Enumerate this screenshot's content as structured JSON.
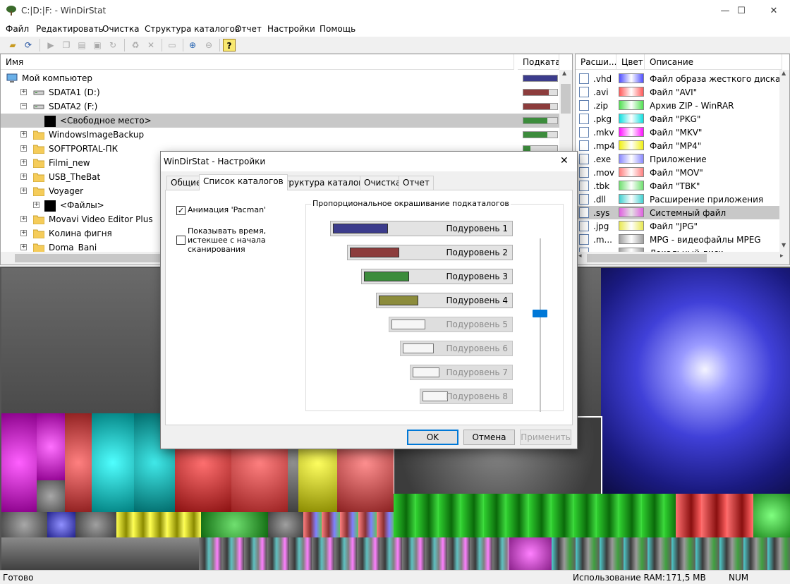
{
  "window": {
    "title": "C:|D:|F: - WinDirStat",
    "minimize_glyph": "—",
    "maximize_glyph": "☐",
    "close_glyph": "✕"
  },
  "menu": [
    "Файл",
    "Редактировать",
    "Очистка",
    "Структура каталогов",
    "Отчет",
    "Настройки",
    "Помощь"
  ],
  "toolbar_icons": [
    "open-folder-icon",
    "refresh-icon",
    "play-icon",
    "copy-icon",
    "explorer-icon",
    "cmd-icon",
    "refresh-selected-icon",
    "recycle-icon",
    "delete-icon",
    "new-folder-icon",
    "zoom-in-icon",
    "zoom-out-icon",
    "help-icon"
  ],
  "tree": {
    "columns": {
      "name": "Имя",
      "subtree": "Подкатал"
    },
    "rows": [
      {
        "name": "Мой компьютер",
        "icon": "computer-icon",
        "expander": "",
        "fill": 1.0,
        "color": "#3c3c8c"
      },
      {
        "name": "SDATA1 (D:)",
        "icon": "drive-icon",
        "expander": "+",
        "fill": 0.75,
        "color": "#8c3c3c"
      },
      {
        "name": "SDATA2 (F:)",
        "icon": "drive-icon",
        "expander": "−",
        "fill": 0.8,
        "color": "#8c3c3c"
      },
      {
        "name": "<Свободное место>",
        "icon": "black-square-icon",
        "expander": "",
        "fill": 0.7,
        "color": "#3c8c3c"
      },
      {
        "name": "WindowsImageBackup",
        "icon": "folder-icon",
        "expander": "+",
        "fill": 0.7,
        "color": "#3c8c3c"
      },
      {
        "name": "SOFTPORTAL-ПК",
        "icon": "folder-icon",
        "expander": "+",
        "fill": 0.2,
        "color": "#3c8c3c"
      },
      {
        "name": "Filmi_new",
        "icon": "folder-icon",
        "expander": "+",
        "fill": 0.0,
        "color": "#3c8c3c"
      },
      {
        "name": "USB_TheBat",
        "icon": "folder-icon",
        "expander": "+",
        "fill": 0.0,
        "color": "#3c8c3c"
      },
      {
        "name": "Voyager",
        "icon": "folder-icon",
        "expander": "+",
        "fill": 0.0,
        "color": "#3c8c3c"
      },
      {
        "name": "<Файлы>",
        "icon": "black-square-icon",
        "expander": "+",
        "fill": 0.0,
        "color": "#3c8c3c"
      },
      {
        "name": "Movavi Video Editor Plus",
        "icon": "folder-icon",
        "expander": "+",
        "fill": 0.0,
        "color": "#3c8c3c"
      },
      {
        "name": "Колина фигня",
        "icon": "folder-icon",
        "expander": "+",
        "fill": 0.0,
        "color": "#3c8c3c"
      },
      {
        "name": "Doma_Bani",
        "icon": "folder-icon",
        "expander": "+",
        "fill": 0.0,
        "color": "#3c8c3c"
      }
    ]
  },
  "extensions": {
    "columns": {
      "ext": "Расши...",
      "color": "Цвет",
      "desc": "Описание",
      "extra": "1"
    },
    "rows": [
      {
        "ext": ".vhd",
        "color": "#5050ff",
        "desc": "Файл образа жесткого диска",
        "icon": "drive-icon"
      },
      {
        "ext": ".avi",
        "color": "#ff5a5a",
        "desc": "Файл \"AVI\"",
        "icon": "video-file-icon"
      },
      {
        "ext": ".zip",
        "color": "#50e050",
        "desc": "Архив ZIP - WinRAR",
        "icon": "winrar-icon"
      },
      {
        "ext": ".pkg",
        "color": "#10e0e0",
        "desc": "Файл \"PKG\"",
        "icon": "file-icon"
      },
      {
        "ext": ".mkv",
        "color": "#ff10ff",
        "desc": "Файл \"MKV\"",
        "icon": "video-file-icon"
      },
      {
        "ext": ".mp4",
        "color": "#f0f010",
        "desc": "Файл \"MP4\"",
        "icon": "video-file-icon"
      },
      {
        "ext": ".exe",
        "color": "#8a8aff",
        "desc": "Приложение",
        "icon": "exe-icon"
      },
      {
        "ext": ".mov",
        "color": "#ff8080",
        "desc": "Файл \"MOV\"",
        "icon": "video-file-icon"
      },
      {
        "ext": ".tbk",
        "color": "#70e070",
        "desc": "Файл \"TBK\"",
        "icon": "file-icon"
      },
      {
        "ext": ".dll",
        "color": "#40d0d0",
        "desc": "Расширение приложения",
        "icon": "dll-icon"
      },
      {
        "ext": ".sys",
        "color": "#e060e0",
        "desc": "Системный файл",
        "icon": "sys-icon"
      },
      {
        "ext": ".jpg",
        "color": "#e8e850",
        "desc": "Файл \"JPG\"",
        "icon": "image-file-icon"
      },
      {
        "ext": ".m...",
        "color": "#a0a0a0",
        "desc": "MPG - видеофайлы MPEG",
        "icon": "mpg-icon"
      },
      {
        "ext": "",
        "color": "#a0a0a0",
        "desc": "Локальный диск",
        "icon": "drive-icon"
      }
    ]
  },
  "dialog": {
    "title": "WinDirStat - Настройки",
    "close_glyph": "✕",
    "tabs": [
      "Общие",
      "Список каталогов",
      "Структура каталогов",
      "Очистка",
      "Отчет"
    ],
    "active_tab": 1,
    "pacman_label": "Анимация 'Pacman'",
    "pacman_checked": true,
    "show_time_label": "Показывать время, истекшее с начала сканирования",
    "show_time_checked": false,
    "group_title": "Пропорциональное окрашивание подкаталогов",
    "levels": [
      {
        "label": "Подуровень 1",
        "color": "#3c3c8c",
        "enabled": true
      },
      {
        "label": "Подуровень 2",
        "color": "#8c3c3c",
        "enabled": true
      },
      {
        "label": "Подуровень 3",
        "color": "#3c8c3c",
        "enabled": true
      },
      {
        "label": "Подуровень 4",
        "color": "#8c8c3c",
        "enabled": true
      },
      {
        "label": "Подуровень 5",
        "color": "#f6f6f6",
        "enabled": false
      },
      {
        "label": "Подуровень 6",
        "color": "#f6f6f6",
        "enabled": false
      },
      {
        "label": "Подуровень 7",
        "color": "#f6f6f6",
        "enabled": false
      },
      {
        "label": "Подуровень 8",
        "color": "#f6f6f6",
        "enabled": false
      }
    ],
    "slider_value": 4,
    "buttons": {
      "ok": "OK",
      "cancel": "Отмена",
      "apply": "Применить"
    }
  },
  "status": {
    "left": "Готово",
    "ram_label": "Использование RAM:",
    "ram_value": "171,5 MB",
    "num": "NUM"
  }
}
